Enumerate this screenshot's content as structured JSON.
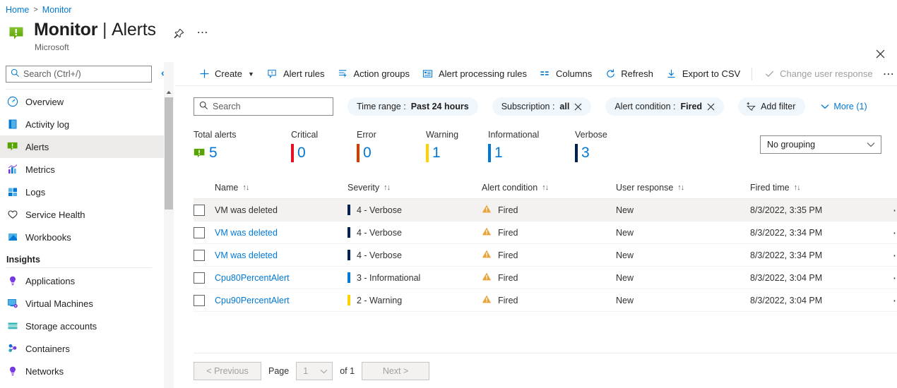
{
  "breadcrumb": {
    "home": "Home",
    "separator": ">",
    "current": "Monitor"
  },
  "header": {
    "title_main": "Monitor",
    "title_sep": "|",
    "title_sub": "Alerts",
    "subtitle": "Microsoft",
    "pin_icon": "pin-icon",
    "more_icon": "ellipsis-icon",
    "close_icon": "close-icon"
  },
  "sidebar": {
    "search_placeholder": "Search (Ctrl+/)",
    "collapse_icon": "double-chevron-left-icon",
    "items": [
      {
        "label": "Overview",
        "icon": "gauge-icon",
        "active": false
      },
      {
        "label": "Activity log",
        "icon": "book-icon",
        "active": false
      },
      {
        "label": "Alerts",
        "icon": "alert-icon",
        "active": true
      },
      {
        "label": "Metrics",
        "icon": "chart-icon",
        "active": false
      },
      {
        "label": "Logs",
        "icon": "logs-icon",
        "active": false
      },
      {
        "label": "Service Health",
        "icon": "heart-icon",
        "active": false
      },
      {
        "label": "Workbooks",
        "icon": "workbook-icon",
        "active": false
      }
    ],
    "group_title": "Insights",
    "insights": [
      {
        "label": "Applications",
        "icon": "bulb-icon"
      },
      {
        "label": "Virtual Machines",
        "icon": "vm-icon"
      },
      {
        "label": "Storage accounts",
        "icon": "storage-icon"
      },
      {
        "label": "Containers",
        "icon": "containers-icon"
      },
      {
        "label": "Networks",
        "icon": "network-icon"
      }
    ]
  },
  "toolbar": {
    "create": "Create",
    "alert_rules": "Alert rules",
    "action_groups": "Action groups",
    "alert_processing_rules": "Alert processing rules",
    "columns": "Columns",
    "refresh": "Refresh",
    "export_csv": "Export to CSV",
    "change_user_response": "Change user response",
    "overflow_icon": "ellipsis-icon"
  },
  "filters": {
    "search_placeholder": "Search",
    "time_range": {
      "label": "Time range :",
      "value": "Past 24 hours"
    },
    "subscription": {
      "label": "Subscription :",
      "value": "all"
    },
    "alert_condition": {
      "label": "Alert condition :",
      "value": "Fired"
    },
    "add_filter": "Add filter",
    "more": "More (1)"
  },
  "summary": [
    {
      "label": "Total alerts",
      "count": "5",
      "icon": "alert-icon",
      "color": "#57a300"
    },
    {
      "label": "Critical",
      "count": "0",
      "color": "#e81123"
    },
    {
      "label": "Error",
      "count": "0",
      "color": "#d83b01"
    },
    {
      "label": "Warning",
      "count": "1",
      "color": "#ffd100"
    },
    {
      "label": "Informational",
      "count": "1",
      "color": "#0078d4"
    },
    {
      "label": "Verbose",
      "count": "3",
      "color": "#002050"
    }
  ],
  "grouping": {
    "value": "No grouping",
    "chevron": "chevron-down-icon"
  },
  "table": {
    "columns": [
      {
        "label": "Name",
        "sort": "↑↓"
      },
      {
        "label": "Severity",
        "sort": "↑↓"
      },
      {
        "label": "Alert condition",
        "sort": "↑↓"
      },
      {
        "label": "User response",
        "sort": "↑↓"
      },
      {
        "label": "Fired time",
        "sort": "↑↓"
      }
    ],
    "rows": [
      {
        "name": "VM was deleted",
        "severity": "4 - Verbose",
        "sev_color": "#002050",
        "condition": "Fired",
        "response": "New",
        "time": "8/3/2022, 3:35 PM",
        "hovered": true
      },
      {
        "name": "VM was deleted",
        "severity": "4 - Verbose",
        "sev_color": "#002050",
        "condition": "Fired",
        "response": "New",
        "time": "8/3/2022, 3:34 PM",
        "hovered": false
      },
      {
        "name": "VM was deleted",
        "severity": "4 - Verbose",
        "sev_color": "#002050",
        "condition": "Fired",
        "response": "New",
        "time": "8/3/2022, 3:34 PM",
        "hovered": false
      },
      {
        "name": "Cpu80PercentAlert",
        "severity": "3 - Informational",
        "sev_color": "#0078d4",
        "condition": "Fired",
        "response": "New",
        "time": "8/3/2022, 3:04 PM",
        "hovered": false
      },
      {
        "name": "Cpu90PercentAlert",
        "severity": "2 - Warning",
        "sev_color": "#ffd100",
        "condition": "Fired",
        "response": "New",
        "time": "8/3/2022, 3:04 PM",
        "hovered": false
      }
    ]
  },
  "pagination": {
    "previous": "< Previous",
    "page_label": "Page",
    "page_value": "1",
    "of_label": "of 1",
    "next": "Next >"
  }
}
